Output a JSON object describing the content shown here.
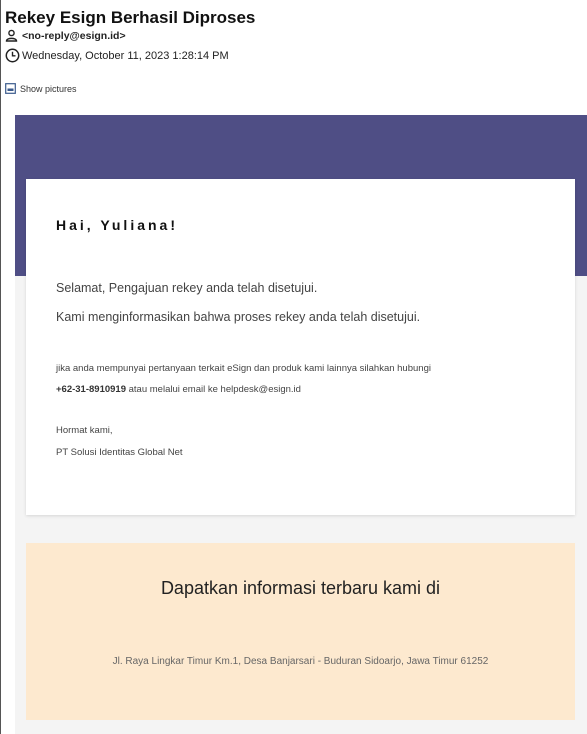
{
  "email": {
    "subject": "Rekey Esign Berhasil Diproses",
    "sender": "<no-reply@esign.id>",
    "date": "Wednesday, October 11, 2023 1:28:14 PM",
    "show_pictures_label": "Show pictures"
  },
  "icons": {
    "person": "person-icon",
    "clock": "clock-icon",
    "image": "image-icon"
  },
  "body": {
    "greeting": "Hai, Yuliana!",
    "line1": "Selamat, Pengajuan rekey anda telah disetujui.",
    "line2": "Kami menginformasikan bahwa proses rekey anda telah disetujui.",
    "contact_prefix": "jika anda mempunyai pertanyaan terkait eSign dan produk kami lainnya silahkan hubungi",
    "phone": "+62-31-8910919",
    "contact_mid": " atau melalui email ke ",
    "contact_email": "helpdesk@esign.id",
    "closing": "Hormat kami,",
    "company": "PT Solusi Identitas Global Net"
  },
  "footer": {
    "title": "Dapatkan informasi terbaru kami di",
    "address": "Jl. Raya Lingkar Timur Km.1, Desa Banjarsari - Buduran Sidoarjo, Jawa Timur 61252"
  },
  "colors": {
    "banner": "#4f4e85",
    "footer_bg": "#fde9cf",
    "content_bg": "#f4f4f4"
  }
}
